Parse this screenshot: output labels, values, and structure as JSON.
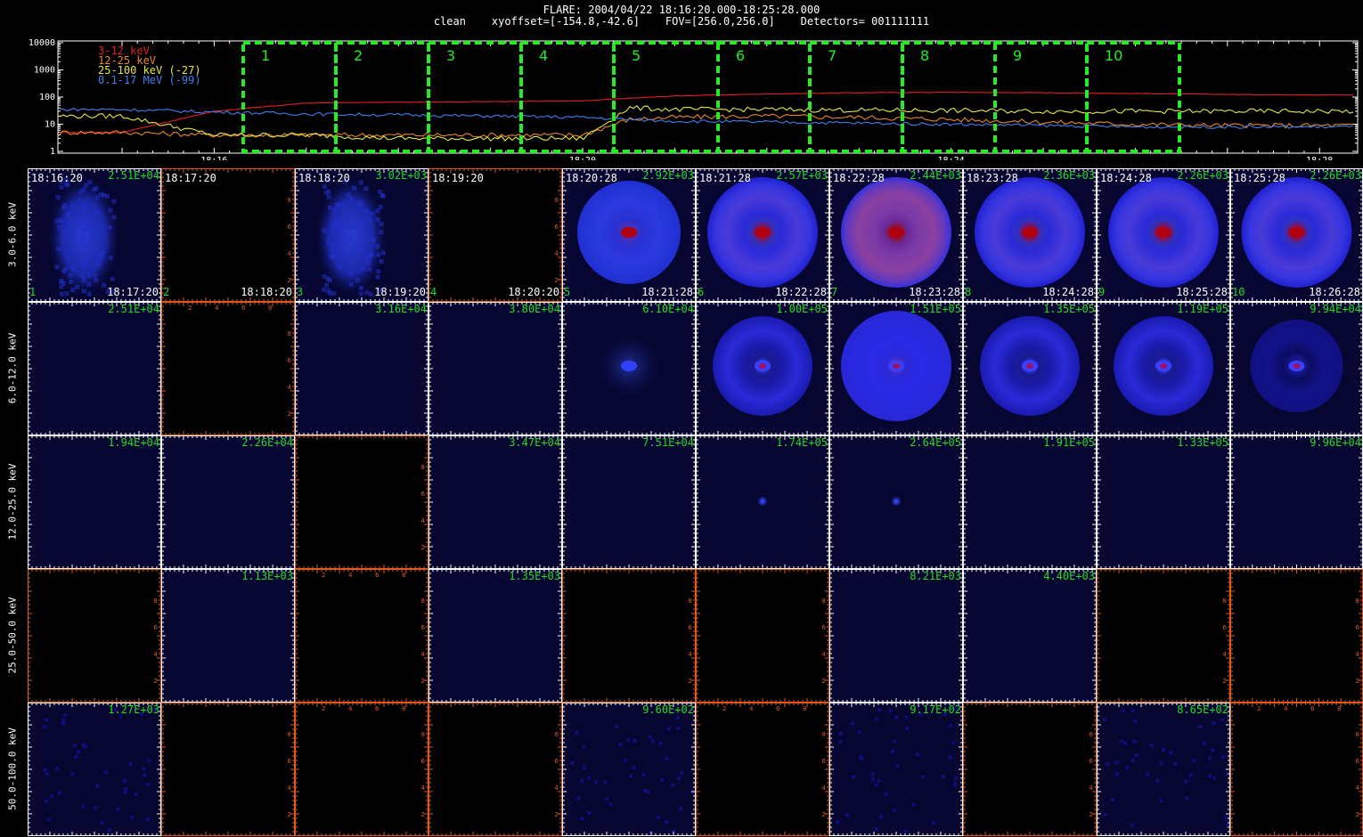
{
  "header": {
    "line1": "FLARE: 2004/04/22 18:16:20.000-18:25:28.000",
    "line2": "clean    xyoffset=[-154.8,-42.6]    FOV=[256.0,256.0]    Detectors= 001111111"
  },
  "colors": {
    "band_3_12": "#e02020",
    "band_12_25": "#e8862a",
    "band_25_100": "#e6e64a",
    "band_01_17": "#3f7ff0",
    "interval_box": "#22ee22",
    "axis_orange": "#e05a20",
    "peak_labels": "#22dd22",
    "image_bg": "#060630"
  },
  "lightcurve": {
    "y_ticks": [
      "10000",
      "1000",
      "100",
      "10",
      "1"
    ],
    "y_values": [
      10000,
      1000,
      100,
      10,
      1
    ],
    "x_tick_labels": [
      "18:16",
      "18:20",
      "18:24",
      "18:28"
    ],
    "legend": [
      {
        "label": "3-12 keV",
        "color": "#e02020"
      },
      {
        "label": "12-25 keV",
        "color": "#e8862a"
      },
      {
        "label": "25-100 keV (-27)",
        "color": "#e6e64a"
      },
      {
        "label": "0.1-17 MeV (-99)",
        "color": "#3f7ff0"
      }
    ],
    "intervals": [
      "1",
      "2",
      "3",
      "4",
      "5",
      "6",
      "7",
      "8",
      "9",
      "10"
    ]
  },
  "chart_data": {
    "type": "line",
    "title": "FLARE: 2004/04/22 18:16:20.000-18:25:28.000",
    "x": [
      "18:15",
      "18:16",
      "18:17",
      "18:18",
      "18:19",
      "18:20",
      "18:20:30",
      "18:21",
      "18:22",
      "18:23",
      "18:24",
      "18:25",
      "18:26",
      "18:27",
      "18:28"
    ],
    "yscale": "log",
    "ylim": [
      1,
      10000
    ],
    "series": [
      {
        "name": "3-12 keV",
        "values": [
          5,
          30,
          60,
          65,
          68,
          72,
          90,
          110,
          130,
          145,
          150,
          145,
          135,
          125,
          120
        ]
      },
      {
        "name": "12-25 keV",
        "values": [
          5,
          4,
          4,
          4,
          4,
          4,
          15,
          18,
          20,
          18,
          15,
          12,
          10,
          9,
          9
        ]
      },
      {
        "name": "25-100 keV (-27)",
        "values": [
          20,
          4,
          4,
          3,
          3,
          3,
          40,
          35,
          35,
          33,
          32,
          30,
          30,
          30,
          30
        ]
      },
      {
        "name": "0.1-17 MeV (-99)",
        "values": [
          35,
          28,
          24,
          22,
          20,
          18,
          15,
          13,
          12,
          11,
          10,
          9,
          8,
          8,
          8
        ]
      }
    ]
  },
  "grid": {
    "energy_bands": [
      "3.0-6.0 keV",
      "6.0-12.0 keV",
      "12.0-25.0 keV",
      "25.0-50.0 keV",
      "50.0-100.0 keV"
    ],
    "interval_numbers": [
      "1",
      "2",
      "3",
      "4",
      "5",
      "6",
      "7",
      "8",
      "9",
      "10"
    ],
    "start_times": [
      "18:16:20",
      "18:17:20",
      "18:18:20",
      "18:19:20",
      "18:20:28",
      "18:21:28",
      "18:22:28",
      "18:23:28",
      "18:24:28",
      "18:25:28"
    ],
    "end_times": [
      "18:17:20",
      "18:18:20",
      "18:19:20",
      "18:20:20",
      "18:21:28",
      "18:22:28",
      "18:23:28",
      "18:24:28",
      "18:25:28",
      "18:26:28"
    ],
    "rows": [
      {
        "peaks": [
          "2.51E+04",
          "",
          "3.02E+03",
          "",
          "2.92E+03",
          "2.57E+03",
          "2.44E+03",
          "2.36E+03",
          "2.26E+03",
          "2.26E+03"
        ],
        "kinds": [
          "blotch",
          "black",
          "blotch",
          "black",
          "ring-faint",
          "ring",
          "ring-strong",
          "ring",
          "ring",
          "ring"
        ]
      },
      {
        "peaks": [
          "2.51E+04",
          "",
          "3.16E+04",
          "3.80E+04",
          "6.10E+04",
          "1.00E+05",
          "1.51E+05",
          "1.35E+05",
          "1.19E+05",
          "9.94E+04"
        ],
        "kinds": [
          "navy",
          "black-axes",
          "navy",
          "navy",
          "dot",
          "ring-blue",
          "ring-blue-strong",
          "ring-blue",
          "ring-blue",
          "ring-blue-faint"
        ]
      },
      {
        "peaks": [
          "1.94E+04",
          "2.26E+04",
          "",
          "3.47E+04",
          "7.51E+04",
          "1.74E+05",
          "2.64E+05",
          "1.91E+05",
          "1.33E+05",
          "9.96E+04"
        ],
        "kinds": [
          "navy",
          "navy",
          "black",
          "navy",
          "navy",
          "navy-dot",
          "navy-dot",
          "navy",
          "navy",
          "navy"
        ]
      },
      {
        "peaks": [
          "",
          "1.13E+03",
          "",
          "1.35E+03",
          "",
          "",
          "8.21E+03",
          "4.40E+03",
          "",
          ""
        ],
        "kinds": [
          "black",
          "navy",
          "black-axes",
          "navy",
          "black",
          "black",
          "navy",
          "navy",
          "black",
          "black"
        ]
      },
      {
        "peaks": [
          "1.27E+03",
          "",
          "",
          "",
          "9.60E+02",
          "",
          "9.17E+02",
          "",
          "8.65E+02",
          ""
        ],
        "kinds": [
          "noise",
          "black",
          "black-axes",
          "black",
          "noise",
          "black-axes",
          "noise",
          "black",
          "noise",
          "black-axes"
        ]
      }
    ],
    "axis_ticks": [
      "2",
      "4",
      "6",
      "8"
    ]
  }
}
